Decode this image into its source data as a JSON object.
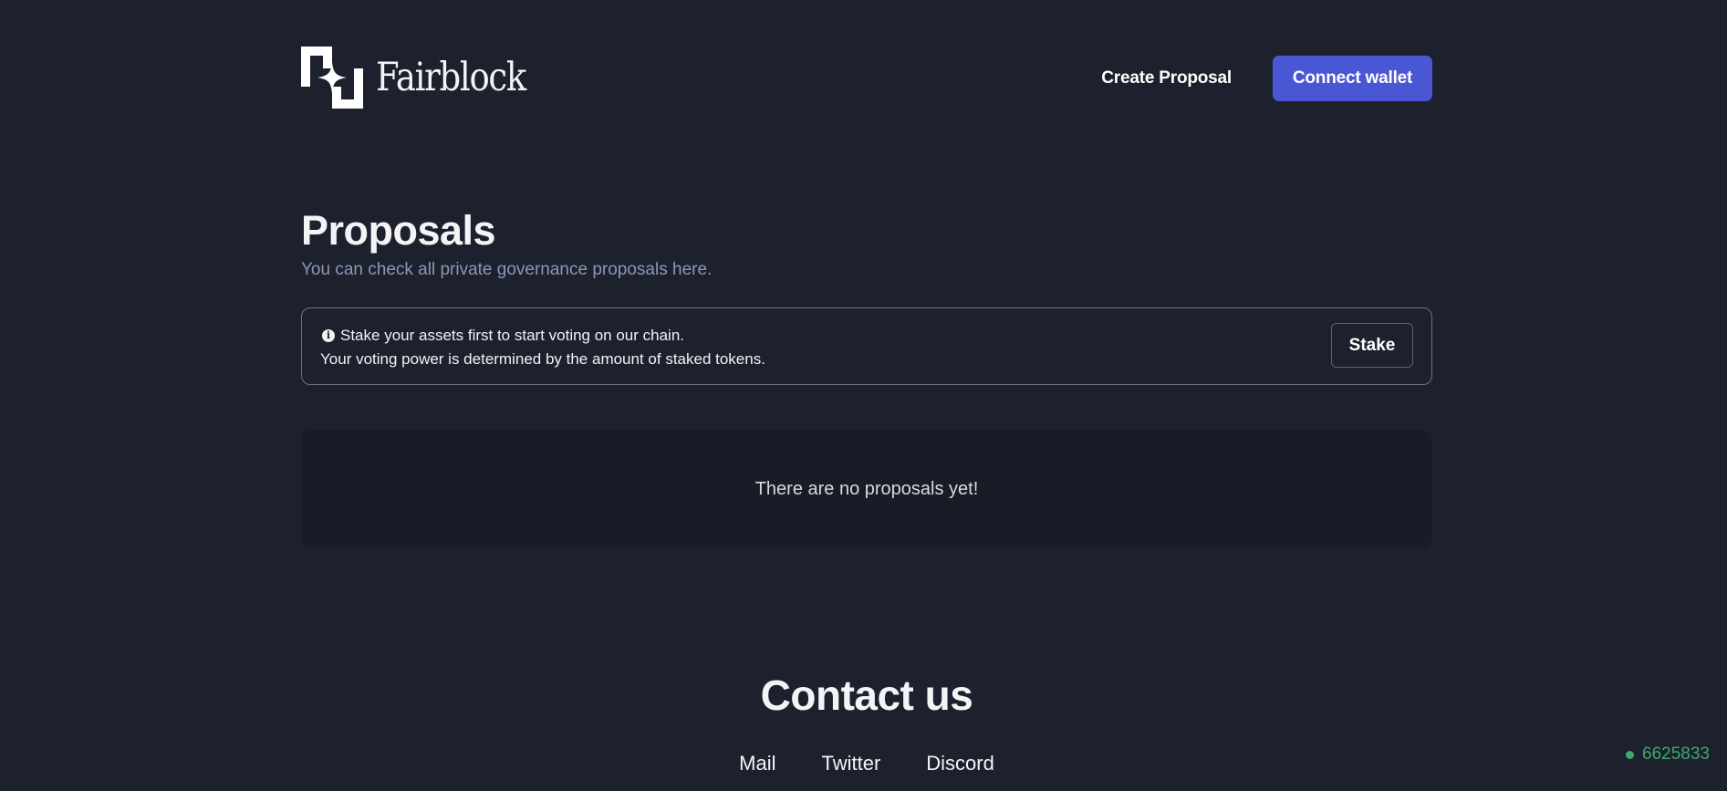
{
  "header": {
    "brand": "Fairblock",
    "nav_create": "Create Proposal",
    "connect_label": "Connect wallet"
  },
  "main": {
    "title": "Proposals",
    "subtitle": "You can check all private governance proposals here.",
    "notice": {
      "line1": "Stake your assets first to start voting on our chain.",
      "line2": "Your voting power is determined by the amount of staked tokens.",
      "stake_label": "Stake"
    },
    "empty_text": "There are no proposals yet!"
  },
  "footer": {
    "contact_title": "Contact us",
    "links": [
      "Mail",
      "Twitter",
      "Discord"
    ]
  },
  "status": {
    "block": "6625833",
    "color": "#3ea86a"
  },
  "colors": {
    "background": "#1c212d",
    "accent": "#4a57d4"
  }
}
